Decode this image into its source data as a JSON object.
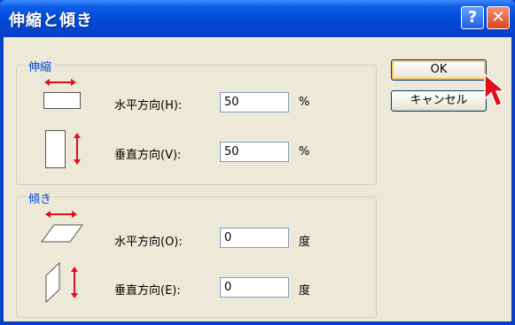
{
  "window": {
    "title": "伸縮と傾き",
    "help_label": "?",
    "close_label": "✕"
  },
  "scale_group": {
    "legend": "伸縮",
    "horizontal_label": "水平方向(H):",
    "horizontal_value": "50",
    "horizontal_unit": "%",
    "vertical_label": "垂直方向(V):",
    "vertical_value": "50",
    "vertical_unit": "%"
  },
  "skew_group": {
    "legend": "傾き",
    "horizontal_label": "水平方向(O):",
    "horizontal_value": "0",
    "horizontal_unit": "度",
    "vertical_label": "垂直方向(E):",
    "vertical_value": "0",
    "vertical_unit": "度"
  },
  "buttons": {
    "ok_label": "OK",
    "cancel_label": "キャンセル"
  },
  "colors": {
    "titlebar": "#0148d6",
    "client_bg": "#ece9d8",
    "group_legend": "#0046d5",
    "arrow_red": "#e0101b"
  },
  "icons": [
    "scale-horizontal-icon",
    "scale-vertical-icon",
    "skew-horizontal-icon",
    "skew-vertical-icon",
    "mouse-cursor-icon"
  ]
}
